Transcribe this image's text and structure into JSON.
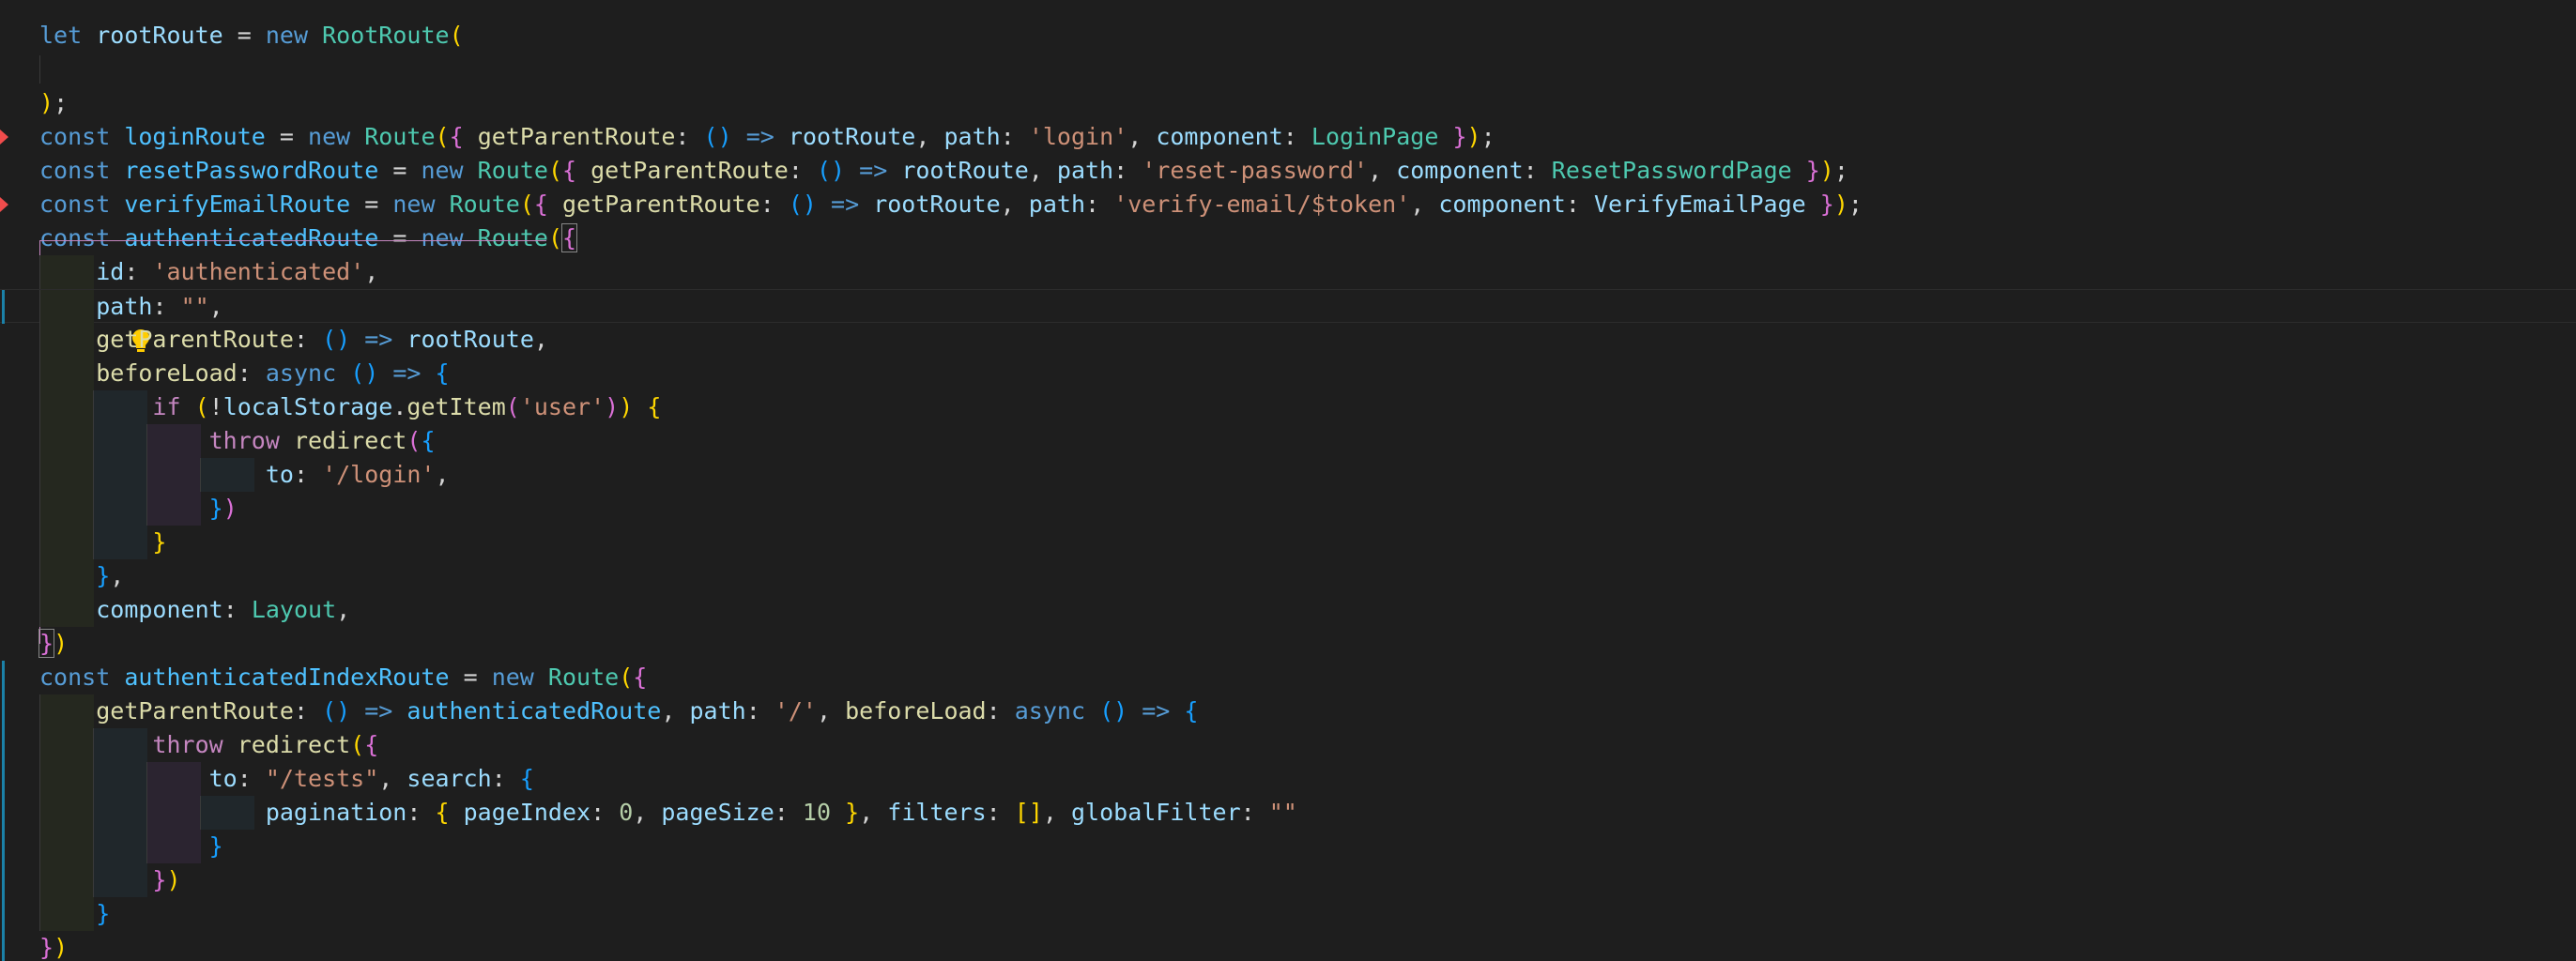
{
  "editor": {
    "language": "typescript",
    "lines": [
      "let rootRoute = new RootRoute(",
      "",
      ");",
      "const loginRoute = new Route({ getParentRoute: () => rootRoute, path: 'login', component: LoginPage });",
      "const resetPasswordRoute = new Route({ getParentRoute: () => rootRoute, path: 'reset-password', component: ResetPasswordPage });",
      "const verifyEmailRoute = new Route({ getParentRoute: () => rootRoute, path: 'verify-email/$token', component: VerifyEmailPage });",
      "const authenticatedRoute = new Route({",
      "    id: 'authenticated',",
      "    path: \"\",",
      "    getParentRoute: () => rootRoute,",
      "    beforeLoad: async () => {",
      "        if (!localStorage.getItem('user')) {",
      "            throw redirect({",
      "                to: '/login',",
      "            })",
      "        }",
      "    },",
      "    component: Layout,",
      "})",
      "const authenticatedIndexRoute = new Route({",
      "    getParentRoute: () => authenticatedRoute, path: '/', beforeLoad: async () => {",
      "        throw redirect({",
      "            to: \"/tests\", search: {",
      "                pagination: { pageIndex: 0, pageSize: 10 }, filters: [], globalFilter: \"\"",
      "            }",
      "        })",
      "    }",
      "})"
    ],
    "markers": {
      "error_lines": [
        4,
        6
      ],
      "modified_lines": [
        8,
        9,
        21,
        28
      ],
      "current_line": 9,
      "lightbulb_line": 9
    },
    "colors": {
      "background": "#1e1e1e",
      "keyword": "#569cd6",
      "control": "#c586c0",
      "variable": "#9cdcfe",
      "function": "#dcdcaa",
      "class": "#4ec9b0",
      "string": "#ce9178",
      "number": "#b5cea8",
      "bracket1": "#ffd700",
      "bracket2": "#da70d6",
      "bracket3": "#179fff",
      "error_marker": "#f14c4c",
      "modified_marker": "#1b81a8",
      "lightbulb": "#ffcc00"
    }
  }
}
